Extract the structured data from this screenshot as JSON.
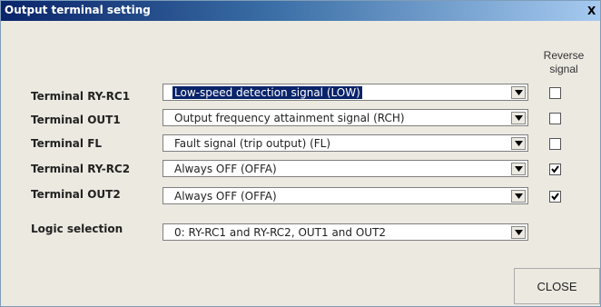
{
  "window": {
    "title": "Output terminal setting",
    "close_glyph": "X"
  },
  "reverse_header": {
    "line1": "Reverse",
    "line2": "signal"
  },
  "rows": [
    {
      "label": "Terminal RY-RC1",
      "value": "Low-speed detection signal (LOW)",
      "reverse": false,
      "selected": true
    },
    {
      "label": "Terminal OUT1",
      "value": "Output frequency attainment signal (RCH)",
      "reverse": false,
      "selected": false
    },
    {
      "label": "Terminal FL",
      "value": "Fault signal (trip output) (FL)",
      "reverse": false,
      "selected": false
    },
    {
      "label": "Terminal RY-RC2",
      "value": "Always OFF (OFFA)",
      "reverse": true,
      "selected": false
    },
    {
      "label": "Terminal OUT2",
      "value": "Always OFF (OFFA)",
      "reverse": true,
      "selected": false
    }
  ],
  "logic": {
    "label": "Logic selection",
    "value": "0: RY-RC1 and RY-RC2, OUT1 and OUT2"
  },
  "close_button": {
    "label": "CLOSE"
  }
}
